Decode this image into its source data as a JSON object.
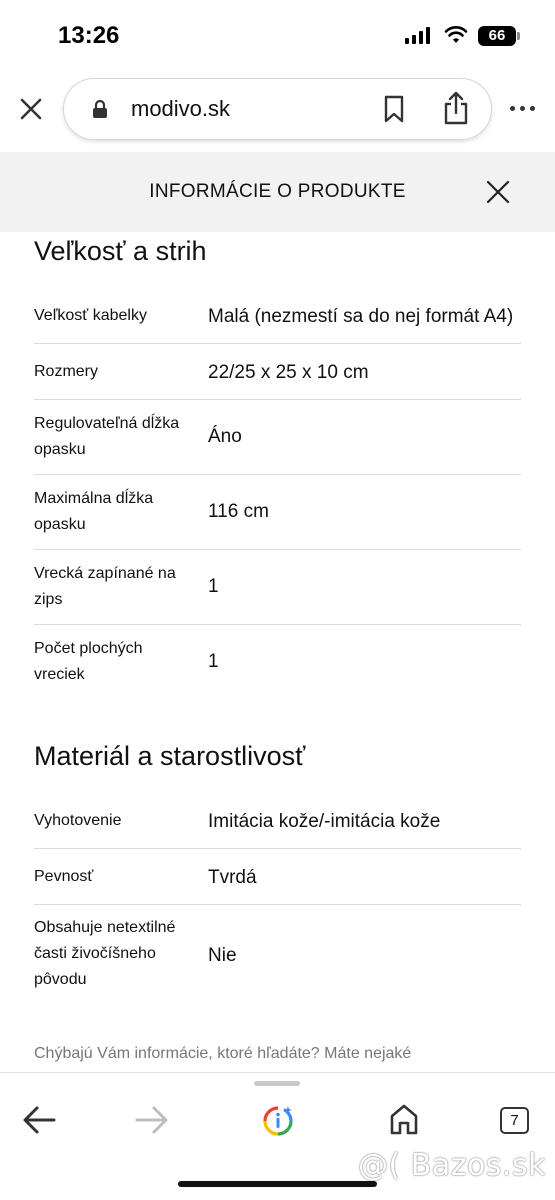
{
  "status_bar": {
    "time": "13:26",
    "battery": "66"
  },
  "browser": {
    "url": "modivo.sk",
    "tab_count": "7"
  },
  "panel": {
    "title": "INFORMÁCIE O PRODUKTE"
  },
  "size_section": {
    "title": "Veľkosť a strih",
    "rows": [
      {
        "label": "Veľkosť kabelky",
        "value": "Malá (nezmestí sa do nej formát A4)"
      },
      {
        "label": "Rozmery",
        "value": "22/25 x 25 x 10 cm"
      },
      {
        "label": "Regulovateľná dĺžka opasku",
        "value": "Áno"
      },
      {
        "label": "Maximálna dĺžka opasku",
        "value": "116 cm"
      },
      {
        "label": "Vrecká zapínané na zips",
        "value": "1"
      },
      {
        "label": "Počet plochých vreciek",
        "value": "1"
      }
    ]
  },
  "material_section": {
    "title": "Materiál a starostlivosť",
    "rows": [
      {
        "label": "Vyhotovenie",
        "value": "Imitácia kože/-imitácia kože"
      },
      {
        "label": "Pevnosť",
        "value": "Tvrdá"
      },
      {
        "label": "Obsahuje netextilné časti živočíšneho pôvodu",
        "value": "Nie"
      }
    ]
  },
  "footer": {
    "note": "Chýbajú Vám informácie, ktoré hľadáte? Máte nejaké"
  },
  "watermark": "@( Bazos.sk",
  "colors": {
    "panel_bg": "#f2f2f2",
    "divider": "#dcdcdc",
    "muted_text": "#777777"
  }
}
